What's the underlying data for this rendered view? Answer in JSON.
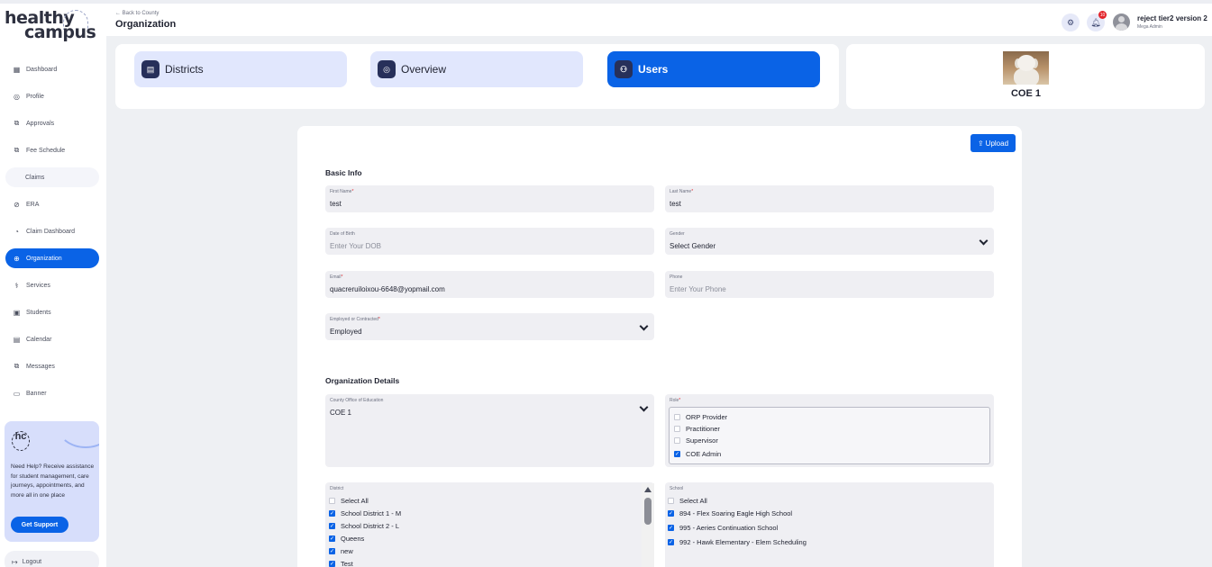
{
  "header": {
    "back_link": "← Back to County",
    "title": "Organization",
    "notification_count": "10",
    "user_name": "reject tier2 version 2",
    "user_role": "Mega Admin"
  },
  "sidebar": {
    "logo_line1": "healthy",
    "logo_line2": "campus",
    "items": [
      {
        "label": "Dashboard",
        "icon": "grid-icon"
      },
      {
        "label": "Profile",
        "icon": "profile-icon"
      },
      {
        "label": "Approvals",
        "icon": "approvals-icon"
      },
      {
        "label": "Fee Schedule",
        "icon": "fee-schedule-icon"
      },
      {
        "label": "Claims",
        "icon": ""
      },
      {
        "label": "ERA",
        "icon": "era-icon"
      },
      {
        "label": "Claim Dashboard",
        "icon": "claim-dashboard-icon"
      },
      {
        "label": "Organization",
        "icon": "globe-icon"
      },
      {
        "label": "Services",
        "icon": "services-icon"
      },
      {
        "label": "Students",
        "icon": "students-icon"
      },
      {
        "label": "Calendar",
        "icon": "calendar-icon"
      },
      {
        "label": "Messages",
        "icon": "messages-icon"
      },
      {
        "label": "Banner",
        "icon": "banner-icon"
      }
    ],
    "help": {
      "logo": "hc",
      "text": "Need Help? Receive assistance for student management, care journeys, appointments, and more all in one place",
      "button": "Get Support"
    },
    "logout": "Logout"
  },
  "tabs": [
    {
      "label": "Districts",
      "active": false
    },
    {
      "label": "Overview",
      "active": false
    },
    {
      "label": "Users",
      "active": true
    }
  ],
  "coe_card": {
    "name": "COE 1"
  },
  "form": {
    "upload_label": "Upload",
    "basic_info_title": "Basic Info",
    "first_name": {
      "label": "First Name",
      "value": "test"
    },
    "last_name": {
      "label": "Last Name",
      "value": "test"
    },
    "dob": {
      "label": "Date of Birth",
      "placeholder": "Enter Your DOB"
    },
    "gender": {
      "label": "Gender",
      "value": "Select Gender"
    },
    "email": {
      "label": "Email",
      "value": "quacreruiloixou-6648@yopmail.com"
    },
    "phone": {
      "label": "Phone",
      "placeholder": "Enter Your Phone"
    },
    "employed": {
      "label": "Employed or Contracted",
      "value": "Employed"
    },
    "org_title": "Organization Details",
    "coe": {
      "label": "County Office of Education",
      "value": "COE 1"
    },
    "role": {
      "label": "Role",
      "options": [
        {
          "label": "ORP Provider",
          "checked": false
        },
        {
          "label": "Practitioner",
          "checked": false
        },
        {
          "label": "Supervisor",
          "checked": false
        },
        {
          "label": "COE Admin",
          "checked": true
        }
      ]
    },
    "district": {
      "label": "District",
      "items": [
        {
          "label": "Select All",
          "checked": false
        },
        {
          "label": "School District 1 - M",
          "checked": true
        },
        {
          "label": "School District 2 - L",
          "checked": true
        },
        {
          "label": "Queens",
          "checked": true
        },
        {
          "label": "new",
          "checked": true
        },
        {
          "label": "Test",
          "checked": true
        }
      ]
    },
    "school": {
      "label": "School",
      "items": [
        {
          "label": "Select All",
          "checked": false
        },
        {
          "label": "894 - Flex Soaring Eagle High School",
          "checked": true
        },
        {
          "label": "995 - Aeries Continuation School",
          "checked": true
        },
        {
          "label": "992 - Hawk Elementary - Elem Scheduling",
          "checked": true
        }
      ]
    }
  },
  "colors": {
    "accent": "#0a63e6",
    "tab_bg": "#e1e7fd",
    "field_bg": "#efeff3",
    "page_bg": "#eef0f3"
  }
}
